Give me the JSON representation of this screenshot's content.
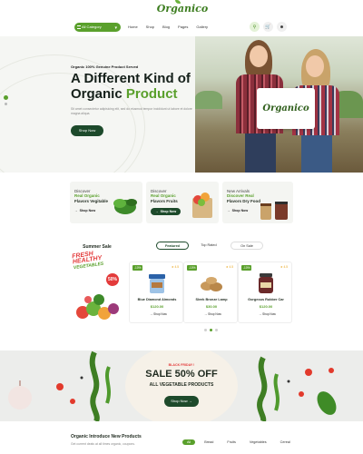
{
  "header": {
    "logo_text": "Organico",
    "category_button": "All Category",
    "nav": [
      "Home",
      "Shop",
      "Blog",
      "Pages",
      "Gallery"
    ],
    "icons": [
      "search-icon",
      "cart-icon",
      "user-icon"
    ]
  },
  "hero": {
    "tagline": "Organic 100% Genuine Product Served",
    "title_line1": "A Different Kind of",
    "title_line2_dark": "Organic",
    "title_line2_accent": "Product",
    "description": "Sit amet consectetur adipisicing elit, sed do eiusmod tempor incididunt ut labore et dolore magna aliqua.",
    "button": "Shop Now",
    "sign_text": "Organico"
  },
  "promos": [
    {
      "line1": "Discover",
      "line2": "Real Organic",
      "line3": "Flavors Vegitable",
      "button": "Shop Now"
    },
    {
      "line1": "Discover",
      "line2": "Real Organic",
      "line3": "Flavors Fruits",
      "button": "Shop Now"
    },
    {
      "line1": "New Arrivals",
      "line2": "Discover Real",
      "line3": "Flavors Dry Food",
      "button": "Shop Now"
    }
  ],
  "summer": {
    "title": "Summer Sale",
    "fresh": "FRESH",
    "healthy": "HEALTHY",
    "vegetables": "VEGETABLES",
    "badge": "50%"
  },
  "product_tabs": [
    "Featured",
    "Top Rated",
    "On Sale"
  ],
  "products": [
    {
      "discount": "-10%",
      "rating": "★ 4.5",
      "name": "Blue Diamond Almonds",
      "price": "$120.00",
      "button": "Shop Now"
    },
    {
      "discount": "-10%",
      "rating": "★ 4.5",
      "name": "Sleek Bronze Lamp",
      "price": "$30.00",
      "button": "Shop Now"
    },
    {
      "discount": "-10%",
      "rating": "★ 4.5",
      "name": "Gorgeous Rubber Car",
      "price": "$120.00",
      "button": "Shop Now"
    }
  ],
  "banner": {
    "pre": "BLACK FRIDAY !",
    "title": "SALE 50% OFF",
    "subtitle": "ALL VEGETABLE PRODUCTS",
    "button": "Shop Now"
  },
  "bottom": {
    "title": "Organic Introduce New Products",
    "description": "Get current deals at all times organic, coupons.",
    "tabs": [
      "All",
      "Bread",
      "Fruits",
      "Vegetables",
      "Cereal"
    ]
  },
  "colors": {
    "accent": "#5aa02c",
    "dark_green": "#1d4a2b",
    "sale_red": "#e33b3b"
  }
}
